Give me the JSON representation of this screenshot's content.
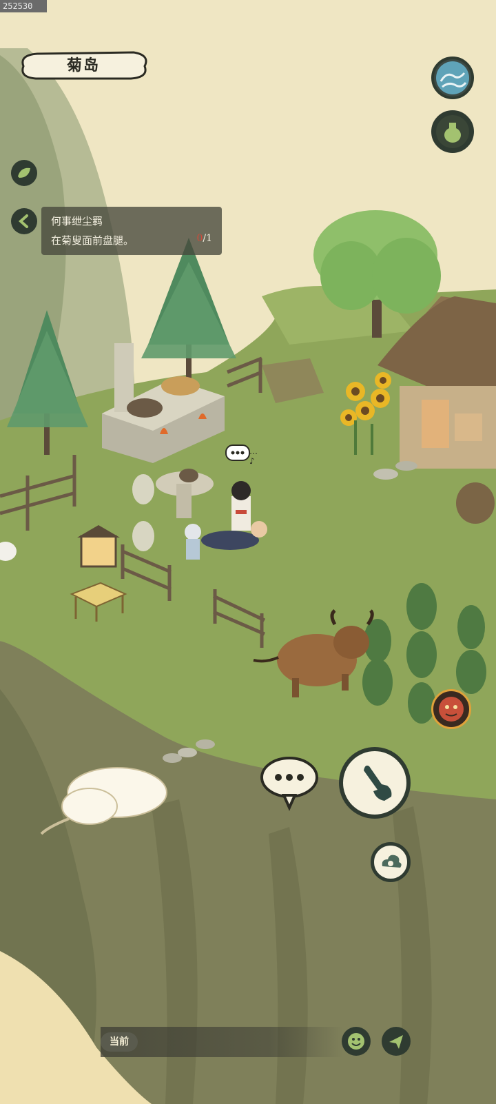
{
  "top_id": "252530",
  "location": {
    "name": "菊岛"
  },
  "quest": {
    "title": "何事绁尘羁",
    "description": "在菊叟面前盘腿。",
    "progress_done": "0",
    "progress_total": "/1"
  },
  "character_bubble": {
    "text": "…♪"
  },
  "bottom_bar": {
    "label": "当前"
  },
  "icons": {
    "wave": "wave-icon",
    "gourd": "gourd-bag-icon",
    "leaf": "leaf-icon",
    "back": "chevron-left-icon",
    "chat": "ellipsis-chat-icon",
    "hand": "pointing-hand-icon",
    "cloud": "cloud-swirl-icon",
    "emoji": "smiley-icon",
    "send": "send-icon",
    "demon": "demon-mask-icon"
  },
  "colors": {
    "grass": "#8fa65a",
    "cliff": "#7c7e55",
    "parchment": "#efe6c3",
    "button_ring": "#2f3b31",
    "quest_bg": "#46483c",
    "progress_red": "#d04a3a"
  }
}
